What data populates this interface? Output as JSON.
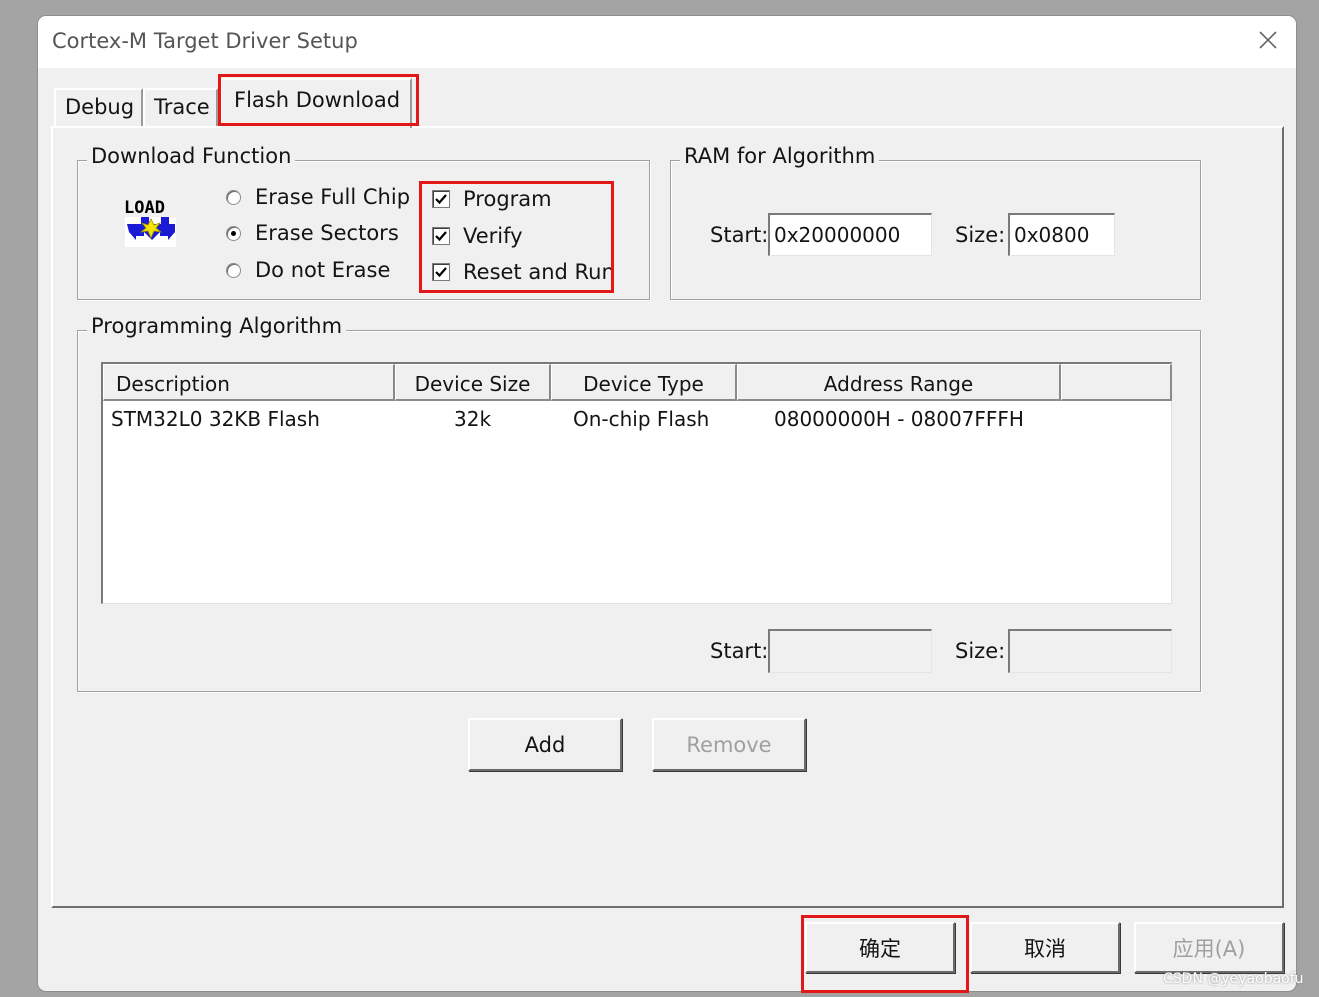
{
  "window": {
    "title": "Cortex-M Target Driver Setup"
  },
  "tabs": [
    {
      "label": "Debug"
    },
    {
      "label": "Trace"
    },
    {
      "label": "Flash Download",
      "active": true
    }
  ],
  "download_function": {
    "legend": "Download Function",
    "load_icon_text": "LOAD",
    "erase_options": [
      {
        "label": "Erase Full Chip",
        "selected": false
      },
      {
        "label": "Erase Sectors",
        "selected": true
      },
      {
        "label": "Do not Erase",
        "selected": false
      }
    ],
    "checks": [
      {
        "label": "Program",
        "checked": true
      },
      {
        "label": "Verify",
        "checked": true
      },
      {
        "label": "Reset and Run",
        "checked": true
      }
    ]
  },
  "ram": {
    "legend": "RAM for Algorithm",
    "start_label": "Start:",
    "start_value": "0x20000000",
    "size_label": "Size:",
    "size_value": "0x0800"
  },
  "algorithm": {
    "legend": "Programming Algorithm",
    "columns": [
      "Description",
      "Device Size",
      "Device Type",
      "Address Range"
    ],
    "rows": [
      {
        "description": "STM32L0 32KB Flash",
        "size": "32k",
        "type": "On-chip Flash",
        "range": "08000000H - 08007FFFH"
      }
    ],
    "start_label": "Start:",
    "start_value": "",
    "size_label": "Size:",
    "size_value": ""
  },
  "buttons": {
    "add": "Add",
    "remove": "Remove",
    "ok": "确定",
    "cancel": "取消",
    "apply": "应用(A)"
  },
  "watermark": "CSDN @yeyaobaofu",
  "colors": {
    "highlight": "#e21818",
    "dialog_bg": "#f0f0f0"
  }
}
